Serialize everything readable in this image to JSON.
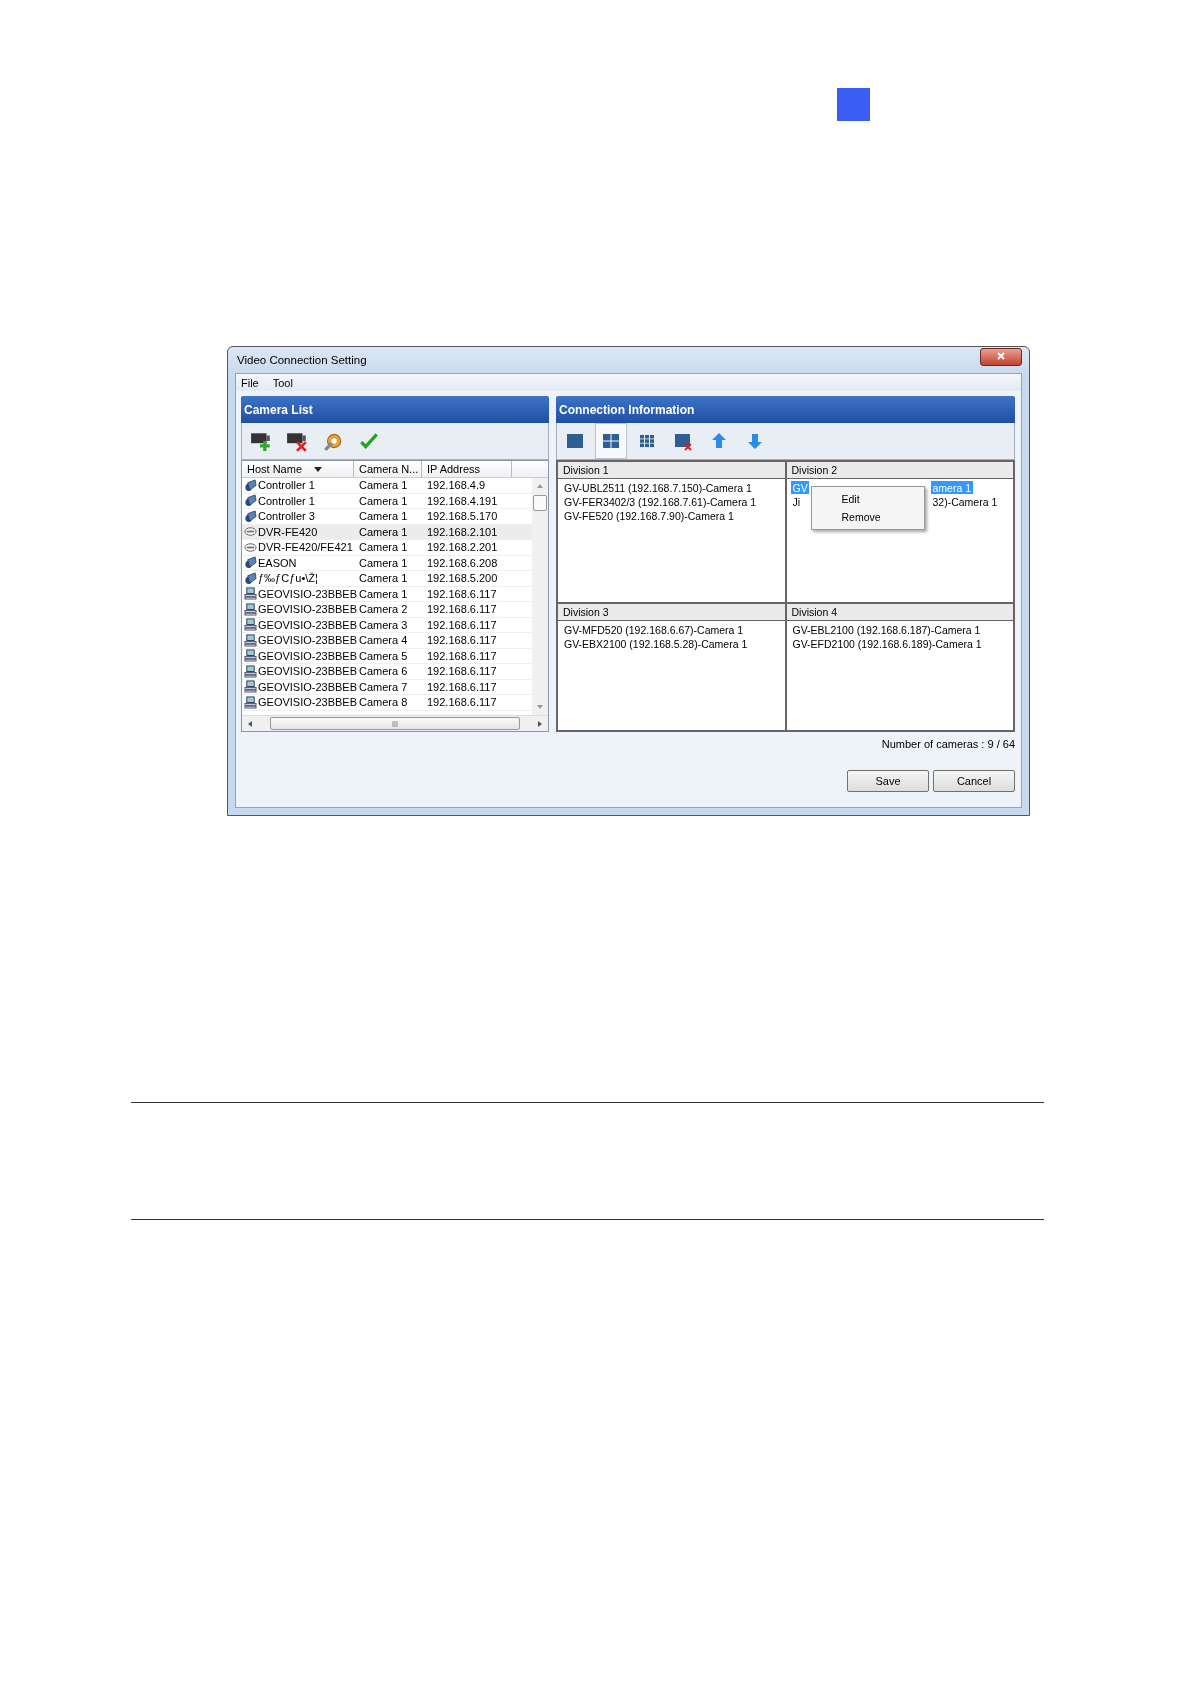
{
  "window": {
    "title": "Video Connection Setting"
  },
  "menu": [
    "File",
    "Tool"
  ],
  "camera_list": {
    "title": "Camera List",
    "tools": [
      {
        "kind": "add"
      },
      {
        "kind": "remove"
      },
      {
        "kind": "settings"
      },
      {
        "kind": "confirm"
      }
    ],
    "columns": [
      "Host Name",
      "Camera N...",
      "IP Address"
    ],
    "rows": [
      {
        "kind": "camera",
        "host": "Controller 1",
        "camera": "Camera 1",
        "ip": "192.168.4.9",
        "selected": false
      },
      {
        "kind": "camera",
        "host": "Controller 1",
        "camera": "Camera 1",
        "ip": "192.168.4.191",
        "selected": false
      },
      {
        "kind": "camera",
        "host": "Controller 3",
        "camera": "Camera 1",
        "ip": "192.168.5.170",
        "selected": false
      },
      {
        "kind": "dvr",
        "host": "DVR-FE420",
        "camera": "Camera 1",
        "ip": "192.168.2.101",
        "selected": true
      },
      {
        "kind": "dvr",
        "host": "DVR-FE420/FE421",
        "camera": "Camera 1",
        "ip": "192.168.2.201",
        "selected": false
      },
      {
        "kind": "camera",
        "host": "EASON",
        "camera": "Camera 1",
        "ip": "192.168.6.208",
        "selected": false
      },
      {
        "kind": "camera",
        "host": "ƒ‰ƒCƒu•\\Ž¦",
        "camera": "Camera 1",
        "ip": "192.168.5.200",
        "selected": false
      },
      {
        "kind": "server",
        "host": "GEOVISIO-23BBEB",
        "camera": "Camera 1",
        "ip": "192.168.6.117",
        "selected": false
      },
      {
        "kind": "server",
        "host": "GEOVISIO-23BBEB",
        "camera": "Camera 2",
        "ip": "192.168.6.117",
        "selected": false
      },
      {
        "kind": "server",
        "host": "GEOVISIO-23BBEB",
        "camera": "Camera 3",
        "ip": "192.168.6.117",
        "selected": false
      },
      {
        "kind": "server",
        "host": "GEOVISIO-23BBEB",
        "camera": "Camera 4",
        "ip": "192.168.6.117",
        "selected": false
      },
      {
        "kind": "server",
        "host": "GEOVISIO-23BBEB",
        "camera": "Camera 5",
        "ip": "192.168.6.117",
        "selected": false
      },
      {
        "kind": "server",
        "host": "GEOVISIO-23BBEB",
        "camera": "Camera 6",
        "ip": "192.168.6.117",
        "selected": false
      },
      {
        "kind": "server",
        "host": "GEOVISIO-23BBEB",
        "camera": "Camera 7",
        "ip": "192.168.6.117",
        "selected": false
      },
      {
        "kind": "server",
        "host": "GEOVISIO-23BBEB",
        "camera": "Camera 8",
        "ip": "192.168.6.117",
        "selected": false
      }
    ]
  },
  "connection": {
    "title": "Connection Information",
    "tools": [
      {
        "kind": "layout-1",
        "selected": false
      },
      {
        "kind": "layout-4",
        "selected": true
      },
      {
        "kind": "layout-9",
        "selected": false
      },
      {
        "kind": "layout-remove",
        "selected": false
      },
      {
        "kind": "up",
        "selected": false
      },
      {
        "kind": "down",
        "selected": false
      }
    ],
    "divisions": [
      {
        "title": "Division 1",
        "items": [
          {
            "left": "GV-UBL2511 (192.168.7.150)-Camera 1",
            "selected": false
          },
          {
            "left": "GV-FER3402/3 (192.168.7.61)-Camera 1",
            "selected": false
          },
          {
            "left": "GV-FE520 (192.168.7.90)-Camera 1",
            "selected": false
          }
        ]
      },
      {
        "title": "Division 2",
        "items": [
          {
            "left": "GV",
            "right": "amera 1",
            "selected": true
          },
          {
            "left": "Ji",
            "right": "32)-Camera 1",
            "selected": false
          }
        ],
        "context_menu": [
          "Edit",
          "Remove"
        ]
      },
      {
        "title": "Division 3",
        "items": [
          {
            "left": "GV-MFD520 (192.168.6.67)-Camera 1",
            "selected": false
          },
          {
            "left": "GV-EBX2100 (192.168.5.28)-Camera 1",
            "selected": false
          }
        ]
      },
      {
        "title": "Division 4",
        "items": [
          {
            "left": "GV-EBL2100 (192.168.6.187)-Camera 1",
            "selected": false
          },
          {
            "left": "GV-EFD2100 (192.168.6.189)-Camera 1",
            "selected": false
          }
        ]
      }
    ],
    "count": "Number of cameras : 9 / 64"
  },
  "buttons": [
    "Save",
    "Cancel"
  ]
}
